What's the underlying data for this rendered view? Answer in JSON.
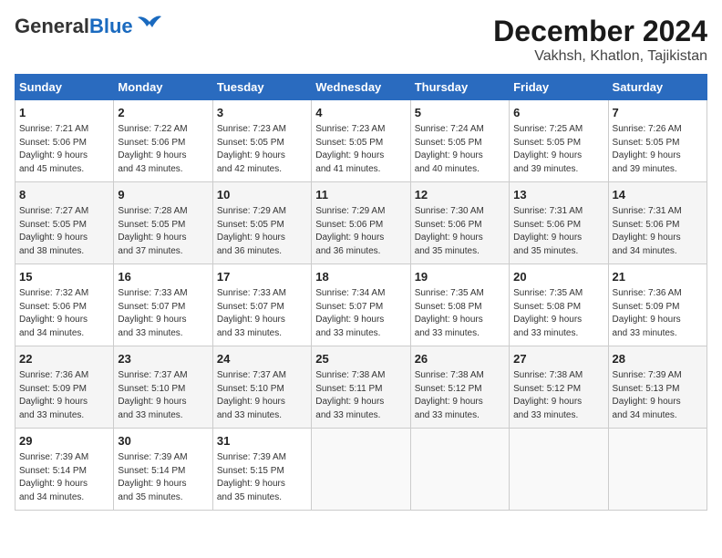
{
  "header": {
    "logo_general": "General",
    "logo_blue": "Blue",
    "title": "December 2024",
    "subtitle": "Vakhsh, Khatlon, Tajikistan"
  },
  "calendar": {
    "days_of_week": [
      "Sunday",
      "Monday",
      "Tuesday",
      "Wednesday",
      "Thursday",
      "Friday",
      "Saturday"
    ],
    "weeks": [
      [
        {
          "day": "",
          "info": ""
        },
        {
          "day": "2",
          "info": "Sunrise: 7:22 AM\nSunset: 5:06 PM\nDaylight: 9 hours\nand 43 minutes."
        },
        {
          "day": "3",
          "info": "Sunrise: 7:23 AM\nSunset: 5:05 PM\nDaylight: 9 hours\nand 42 minutes."
        },
        {
          "day": "4",
          "info": "Sunrise: 7:23 AM\nSunset: 5:05 PM\nDaylight: 9 hours\nand 41 minutes."
        },
        {
          "day": "5",
          "info": "Sunrise: 7:24 AM\nSunset: 5:05 PM\nDaylight: 9 hours\nand 40 minutes."
        },
        {
          "day": "6",
          "info": "Sunrise: 7:25 AM\nSunset: 5:05 PM\nDaylight: 9 hours\nand 39 minutes."
        },
        {
          "day": "7",
          "info": "Sunrise: 7:26 AM\nSunset: 5:05 PM\nDaylight: 9 hours\nand 39 minutes."
        }
      ],
      [
        {
          "day": "1",
          "info": "Sunrise: 7:21 AM\nSunset: 5:06 PM\nDaylight: 9 hours\nand 45 minutes."
        },
        {
          "day": "9",
          "info": "Sunrise: 7:28 AM\nSunset: 5:05 PM\nDaylight: 9 hours\nand 37 minutes."
        },
        {
          "day": "10",
          "info": "Sunrise: 7:29 AM\nSunset: 5:05 PM\nDaylight: 9 hours\nand 36 minutes."
        },
        {
          "day": "11",
          "info": "Sunrise: 7:29 AM\nSunset: 5:06 PM\nDaylight: 9 hours\nand 36 minutes."
        },
        {
          "day": "12",
          "info": "Sunrise: 7:30 AM\nSunset: 5:06 PM\nDaylight: 9 hours\nand 35 minutes."
        },
        {
          "day": "13",
          "info": "Sunrise: 7:31 AM\nSunset: 5:06 PM\nDaylight: 9 hours\nand 35 minutes."
        },
        {
          "day": "14",
          "info": "Sunrise: 7:31 AM\nSunset: 5:06 PM\nDaylight: 9 hours\nand 34 minutes."
        }
      ],
      [
        {
          "day": "8",
          "info": "Sunrise: 7:27 AM\nSunset: 5:05 PM\nDaylight: 9 hours\nand 38 minutes."
        },
        {
          "day": "16",
          "info": "Sunrise: 7:33 AM\nSunset: 5:07 PM\nDaylight: 9 hours\nand 33 minutes."
        },
        {
          "day": "17",
          "info": "Sunrise: 7:33 AM\nSunset: 5:07 PM\nDaylight: 9 hours\nand 33 minutes."
        },
        {
          "day": "18",
          "info": "Sunrise: 7:34 AM\nSunset: 5:07 PM\nDaylight: 9 hours\nand 33 minutes."
        },
        {
          "day": "19",
          "info": "Sunrise: 7:35 AM\nSunset: 5:08 PM\nDaylight: 9 hours\nand 33 minutes."
        },
        {
          "day": "20",
          "info": "Sunrise: 7:35 AM\nSunset: 5:08 PM\nDaylight: 9 hours\nand 33 minutes."
        },
        {
          "day": "21",
          "info": "Sunrise: 7:36 AM\nSunset: 5:09 PM\nDaylight: 9 hours\nand 33 minutes."
        }
      ],
      [
        {
          "day": "15",
          "info": "Sunrise: 7:32 AM\nSunset: 5:06 PM\nDaylight: 9 hours\nand 34 minutes."
        },
        {
          "day": "23",
          "info": "Sunrise: 7:37 AM\nSunset: 5:10 PM\nDaylight: 9 hours\nand 33 minutes."
        },
        {
          "day": "24",
          "info": "Sunrise: 7:37 AM\nSunset: 5:10 PM\nDaylight: 9 hours\nand 33 minutes."
        },
        {
          "day": "25",
          "info": "Sunrise: 7:38 AM\nSunset: 5:11 PM\nDaylight: 9 hours\nand 33 minutes."
        },
        {
          "day": "26",
          "info": "Sunrise: 7:38 AM\nSunset: 5:12 PM\nDaylight: 9 hours\nand 33 minutes."
        },
        {
          "day": "27",
          "info": "Sunrise: 7:38 AM\nSunset: 5:12 PM\nDaylight: 9 hours\nand 33 minutes."
        },
        {
          "day": "28",
          "info": "Sunrise: 7:39 AM\nSunset: 5:13 PM\nDaylight: 9 hours\nand 34 minutes."
        }
      ],
      [
        {
          "day": "22",
          "info": "Sunrise: 7:36 AM\nSunset: 5:09 PM\nDaylight: 9 hours\nand 33 minutes."
        },
        {
          "day": "30",
          "info": "Sunrise: 7:39 AM\nSunset: 5:14 PM\nDaylight: 9 hours\nand 35 minutes."
        },
        {
          "day": "31",
          "info": "Sunrise: 7:39 AM\nSunset: 5:15 PM\nDaylight: 9 hours\nand 35 minutes."
        },
        {
          "day": "",
          "info": ""
        },
        {
          "day": "",
          "info": ""
        },
        {
          "day": "",
          "info": ""
        },
        {
          "day": "",
          "info": ""
        }
      ],
      [
        {
          "day": "29",
          "info": "Sunrise: 7:39 AM\nSunset: 5:14 PM\nDaylight: 9 hours\nand 34 minutes."
        },
        {
          "day": "",
          "info": ""
        },
        {
          "day": "",
          "info": ""
        },
        {
          "day": "",
          "info": ""
        },
        {
          "day": "",
          "info": ""
        },
        {
          "day": "",
          "info": ""
        },
        {
          "day": "",
          "info": ""
        }
      ]
    ]
  }
}
